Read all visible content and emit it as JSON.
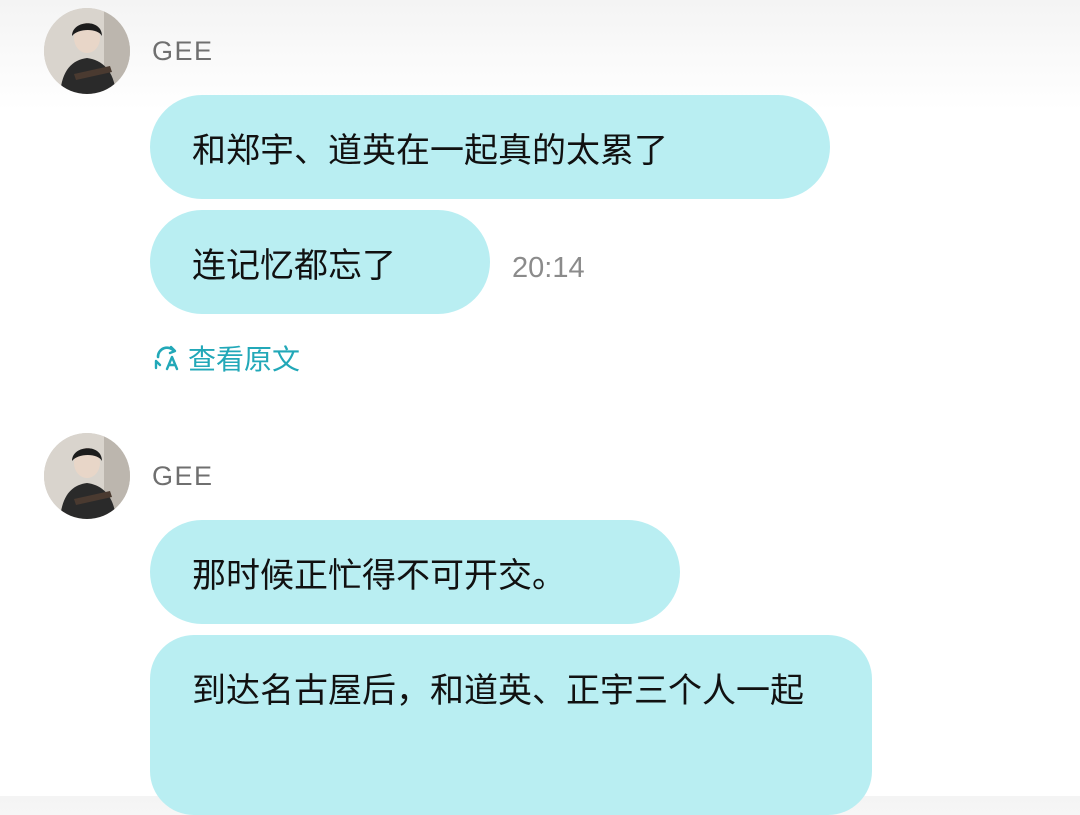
{
  "messages": [
    {
      "sender": "GEE",
      "bubbles": [
        "和郑宇、道英在一起真的太累了",
        "连记忆都忘了"
      ],
      "time": "20:14",
      "view_original": "查看原文"
    },
    {
      "sender": "GEE",
      "bubbles": [
        "那时候正忙得不可开交。",
        "到达名古屋后，和道英、正宇三个人一起"
      ]
    }
  ],
  "colors": {
    "bubble": "#b9eef2",
    "link": "#22a8b8",
    "sender": "#6f6f6f",
    "time": "#8b8b8b"
  },
  "icons": {
    "avatar": "avatar-photo",
    "translate": "translate-icon"
  }
}
